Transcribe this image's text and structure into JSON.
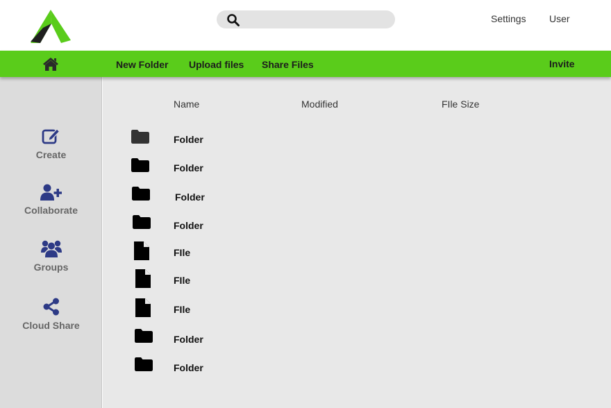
{
  "header": {
    "search": {
      "placeholder": "",
      "value": ""
    },
    "links": {
      "settings": "Settings",
      "user": "User"
    }
  },
  "toolbar": {
    "new_folder": "New Folder",
    "upload_files": "Upload files",
    "share_files": "Share Files",
    "invite": "Invite"
  },
  "sidebar": {
    "items": [
      {
        "label": "Create",
        "icon": "edit-icon"
      },
      {
        "label": "Collaborate",
        "icon": "user-plus-icon"
      },
      {
        "label": "Groups",
        "icon": "users-icon"
      },
      {
        "label": "Cloud Share",
        "icon": "share-nodes-icon"
      }
    ]
  },
  "files": {
    "columns": {
      "name": "Name",
      "modified": "Modified",
      "size": "FIle Size"
    },
    "rows": [
      {
        "type": "folder",
        "name": "Folder"
      },
      {
        "type": "folder",
        "name": "Folder"
      },
      {
        "type": "folder",
        "name": "Folder"
      },
      {
        "type": "folder",
        "name": "Folder"
      },
      {
        "type": "file",
        "name": "FIle"
      },
      {
        "type": "file",
        "name": "FIle"
      },
      {
        "type": "file",
        "name": "FIle"
      },
      {
        "type": "folder",
        "name": "Folder"
      },
      {
        "type": "folder",
        "name": "Folder"
      }
    ]
  },
  "colors": {
    "accent": "#5acc1b",
    "sidebar_icon": "#2d3a86",
    "sidebar_bg": "#dcdcdc",
    "main_bg": "#e8e8e8"
  }
}
